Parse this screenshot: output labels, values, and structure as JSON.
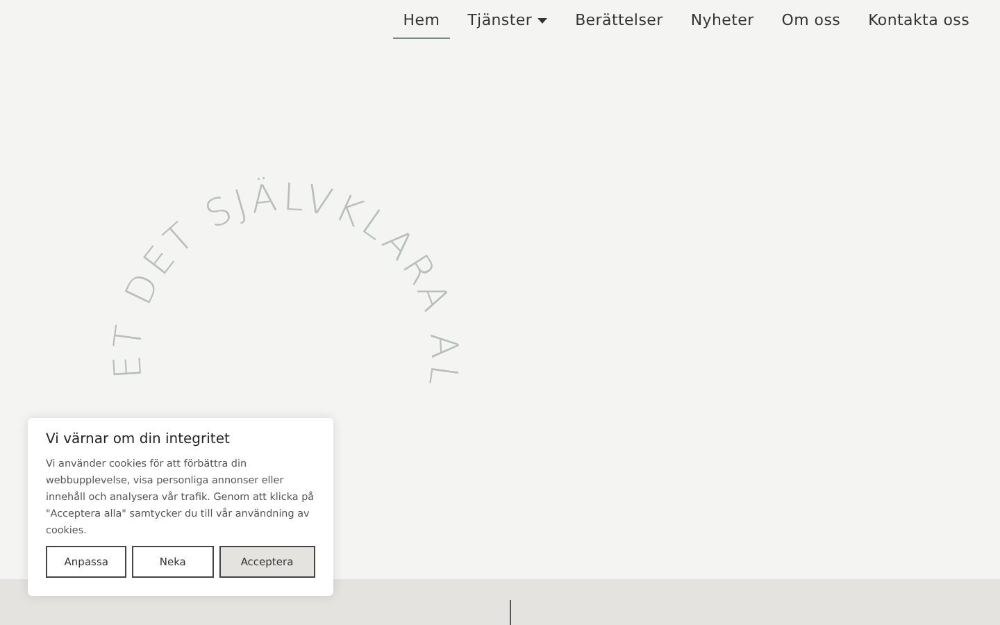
{
  "nav": {
    "items": [
      {
        "label": "Hem",
        "selected": true,
        "dropdown": false
      },
      {
        "label": "Tjänster",
        "selected": false,
        "dropdown": true
      },
      {
        "label": "Berättelser",
        "selected": false,
        "dropdown": false
      },
      {
        "label": "Nyheter",
        "selected": false,
        "dropdown": false
      },
      {
        "label": "Om oss",
        "selected": false,
        "dropdown": false
      },
      {
        "label": "Kontakta oss",
        "selected": false,
        "dropdown": false
      }
    ]
  },
  "hero": {
    "circle_text": "ET DET SJÄLVKLARA AL"
  },
  "cookie_banner": {
    "title": "Vi värnar om din integritet",
    "body": "Vi använder cookies för att förbättra din webbupplevelse, visa personliga annonser eller innehåll och analysera vår trafik. Genom att klicka på \"Acceptera alla\" samtycker du till vår användning av cookies.",
    "buttons": [
      {
        "label": "Anpassa",
        "primary": false
      },
      {
        "label": "Neka",
        "primary": false
      },
      {
        "label": "Acceptera",
        "primary": true
      }
    ]
  }
}
